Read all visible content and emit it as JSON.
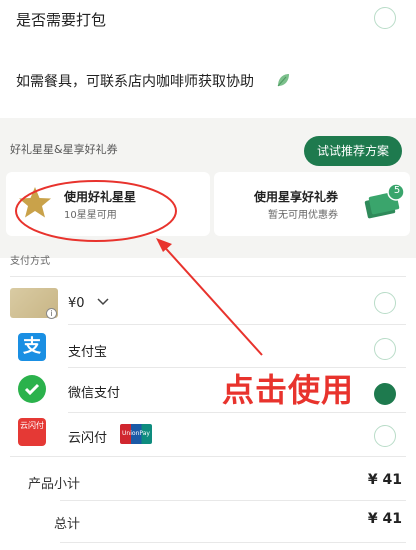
{
  "packing": {
    "label": "是否需要打包"
  },
  "utensil_note": {
    "text": "如需餐具，可联系店内咖啡师获取协助"
  },
  "rewards": {
    "section_title": "好礼星星&星享好礼券",
    "try_button": "试试推荐方案",
    "stars_card": {
      "title": "使用好礼星星",
      "subtitle": "10星星可用"
    },
    "coupon_card": {
      "title": "使用星享好礼券",
      "subtitle": "暂无可用优惠券",
      "badge": "5"
    }
  },
  "payment": {
    "header": "支付方式",
    "gift_card": {
      "amount": "¥0",
      "chevron": "chevron-down-icon"
    },
    "alipay": {
      "label": "支付宝",
      "icon_glyph": "支"
    },
    "wechat": {
      "label": "微信支付",
      "selected": true
    },
    "quickpass": {
      "label": "云闪付",
      "icon_text": "云闪付",
      "unionpay_text": "UnionPay 银联"
    }
  },
  "annotation": {
    "text": "点击使用"
  },
  "summary": {
    "subtotal_label": "产品小计",
    "subtotal_value": "¥ 41",
    "total_label": "总计",
    "total_value": "¥ 41"
  },
  "colors": {
    "brand_green": "#1e7a4e",
    "annotation_red": "#e8332d"
  }
}
